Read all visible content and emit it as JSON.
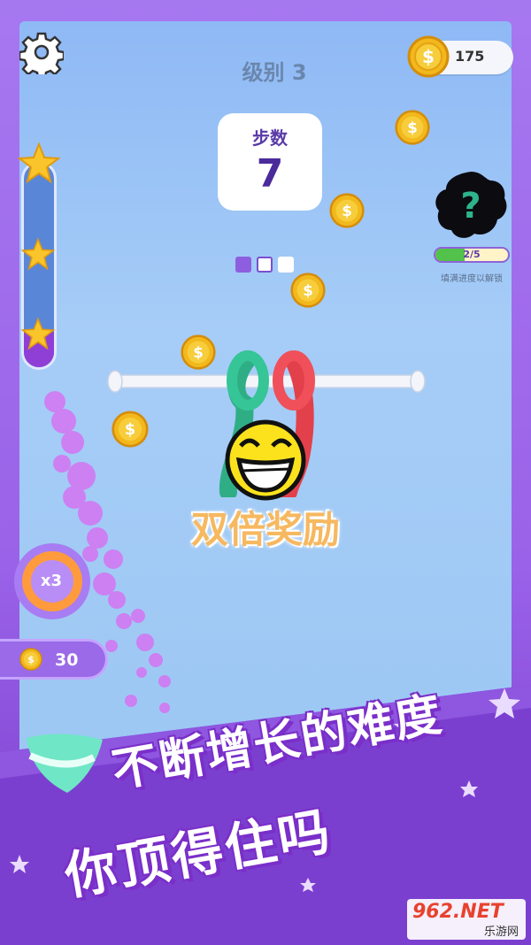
{
  "header": {
    "level_label": "级别 3",
    "coins": "175"
  },
  "steps": {
    "label": "步数",
    "value": "7"
  },
  "mystery": {
    "progress_text": "2/5",
    "progress": 0.4,
    "unlock_hint": "填满进度以解锁"
  },
  "center": {
    "reward_text": "双倍奖励"
  },
  "multiplier": {
    "label": "x3",
    "coins": "30"
  },
  "banner": {
    "line1": "不断增长的难度",
    "line2": "你顶得住吗"
  },
  "watermark": {
    "brand": "962.NET",
    "sub": "乐游网"
  },
  "colors": {
    "accent": "#7a2fc9",
    "sky": "#a6cdf7",
    "coin": "#f2b81c",
    "rope_green": "#2fae86",
    "rope_red": "#e2404b"
  },
  "icons": [
    "gear-icon",
    "coin-icon",
    "star-icon",
    "question-icon",
    "smiley-icon"
  ]
}
